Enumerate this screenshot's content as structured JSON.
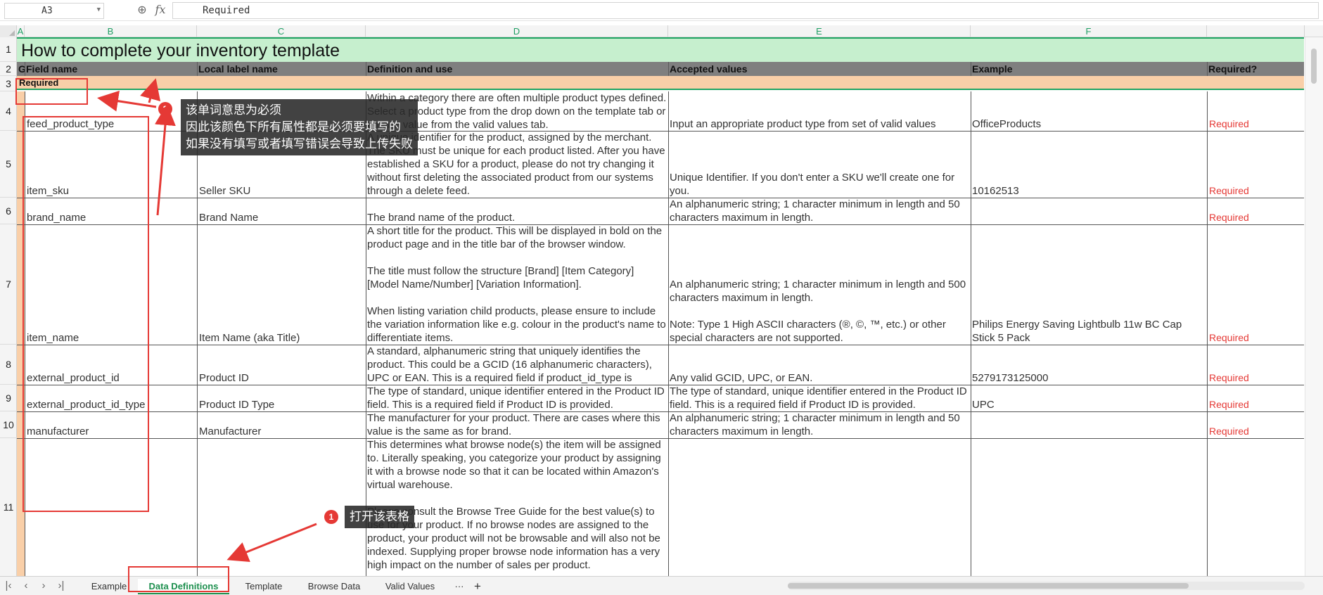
{
  "formula_bar": {
    "cell_ref": "A3",
    "zoom_icon": "zoom-icon",
    "fx_label": "fx",
    "value": "Required"
  },
  "columns": [
    "A",
    "B",
    "C",
    "D",
    "E",
    "F"
  ],
  "row_numbers": [
    "1",
    "2",
    "3",
    "4",
    "5",
    "6",
    "7",
    "8",
    "9",
    "10",
    "11"
  ],
  "sheet": {
    "title": "How to complete your inventory template",
    "header": {
      "group": "Gr",
      "field_name": "Field name",
      "local_label": "Local label name",
      "definition": "Definition and use",
      "accepted": "Accepted values",
      "example": "Example",
      "required": "Required?"
    },
    "section_label": "Required",
    "rows": [
      {
        "field": "feed_product_type",
        "label": "",
        "definition": "Within a category there are often multiple product types defined. Select a product type from the drop down on the template tab or enter a value from the valid values tab.",
        "accepted": "Input an appropriate product type from set of valid values",
        "example": "OfficeProducts",
        "required": "Required"
      },
      {
        "field": "item_sku",
        "label": "Seller SKU",
        "definition": "A unique identifier for the product, assigned by the merchant. The SKU must be unique for each product listed.  After you have established a SKU for a product, please do not try changing it without first deleting the associated product from our systems through a delete feed.",
        "accepted": "Unique Identifier. If you don't enter a SKU we'll create one for you.",
        "example": "10162513",
        "required": "Required"
      },
      {
        "field": "brand_name",
        "label": "Brand Name",
        "definition": "The brand name of the product.",
        "accepted": "An alphanumeric string; 1 character minimum in length and 50 characters maximum in length.",
        "example": "",
        "required": "Required"
      },
      {
        "field": "item_name",
        "label": "Item Name (aka Title)",
        "definition_p1": "A short title for the product. This will be displayed in bold on the product page and in the title bar of the browser window.",
        "definition_p2": "The title must follow the structure [Brand] [Item Category] [Model Name/Number] [Variation Information].",
        "definition_p3": "When listing variation child products, please ensure to include the variation information like e.g. colour in the product's name to differentiate items.",
        "accepted_p1": "An alphanumeric string; 1 character minimum in length and 500 characters maximum in length.",
        "accepted_p2": "Note: Type 1 High ASCII characters (®, ©, ™, etc.) or other special characters are not supported.",
        "example": "Philips Energy Saving Lightbulb 11w BC Cap Stick 5 Pack",
        "required": "Required"
      },
      {
        "field": "external_product_id",
        "label": "Product ID",
        "definition": "A standard, alphanumeric string that uniquely identifies the product. This could be a GCID (16 alphanumeric characters), UPC or EAN. This is a required field if product_id_type is provided.",
        "accepted": "Any valid GCID, UPC, or EAN.",
        "example": "5279173125000",
        "required": "Required"
      },
      {
        "field": "external_product_id_type",
        "label": "Product ID Type",
        "definition": "The type of standard, unique identifier entered in the Product ID field. This is a required field if Product ID is provided.",
        "accepted": "The type of standard, unique identifier entered in the Product ID field. This is a required field if Product ID is provided.",
        "example": "UPC",
        "required": "Required"
      },
      {
        "field": "manufacturer",
        "label": "Manufacturer",
        "definition": "The manufacturer for your product. There are cases where this value is the same as for brand.",
        "accepted": "An alphanumeric string; 1 character minimum in length and 50 characters maximum in length.",
        "example": "",
        "required": "Required"
      },
      {
        "field": "",
        "label": "",
        "definition_p1": "This determines what browse node(s) the item will be assigned to.  Literally speaking, you categorize your product by assigning it with a browse node so that it can be located within Amazon's virtual warehouse.",
        "definition_p2": "Please consult the Browse Tree Guide for the best value(s) to use for your product.  If no browse nodes are assigned to the product, your product will not be browsable and will also not be indexed. Supplying proper browse node information has a very high impact on the number of sales per product.",
        "accepted": "",
        "example": "",
        "required": ""
      }
    ]
  },
  "annotations": {
    "badge1": "1",
    "callout1": "打开该表格",
    "badge2": "2",
    "callout2_line1": "该单词意思为必须",
    "callout2_line2": "因此该颜色下所有属性都是必须要填写的",
    "callout2_line3": "如果没有填写或者填写错误会导致上传失败",
    "accent_color": "#e53935"
  },
  "tabs": {
    "items": [
      "Example",
      "Data Definitions",
      "Template",
      "Browse Data",
      "Valid Values"
    ],
    "active": "Data Definitions",
    "more": "···",
    "add": "+"
  },
  "colors": {
    "title_bg": "#c6efce",
    "header_bg": "#7f7f7f",
    "required_bg": "#f9cfa8",
    "required_text": "#e53935",
    "accent_green": "#1d8f4e"
  }
}
